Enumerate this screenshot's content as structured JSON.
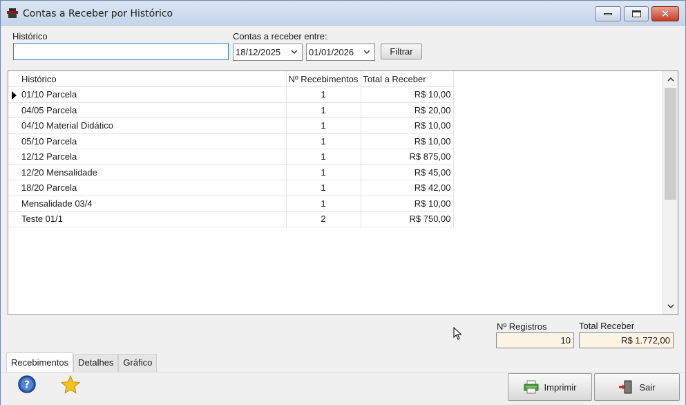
{
  "window": {
    "title": "Contas a Receber por Histórico"
  },
  "filters": {
    "historico_label": "Histórico",
    "historico_value": "",
    "range_label": "Contas a receber entre:",
    "date_from": "18/12/2025",
    "date_to": "01/01/2026",
    "filter_button": "Filtrar"
  },
  "table": {
    "headers": {
      "historico": "Histórico",
      "n_recebimentos": "Nº Recebimentos",
      "total": "Total a Receber"
    },
    "rows": [
      {
        "historico": "01/10 Parcela",
        "n": "1",
        "total": "R$ 10,00"
      },
      {
        "historico": "04/05 Parcela",
        "n": "1",
        "total": "R$ 20,00"
      },
      {
        "historico": "04/10 Material Didático",
        "n": "1",
        "total": "R$ 10,00"
      },
      {
        "historico": "05/10 Parcela",
        "n": "1",
        "total": "R$ 10,00"
      },
      {
        "historico": "12/12 Parcela",
        "n": "1",
        "total": "R$ 875,00"
      },
      {
        "historico": "12/20 Mensalidade",
        "n": "1",
        "total": "R$ 45,00"
      },
      {
        "historico": "18/20 Parcela",
        "n": "1",
        "total": "R$ 42,00"
      },
      {
        "historico": "Mensalidade 03/4",
        "n": "1",
        "total": "R$ 10,00"
      },
      {
        "historico": "Teste 01/1",
        "n": "2",
        "total": "R$ 750,00"
      }
    ]
  },
  "summary": {
    "n_registros_label": "Nº Registros",
    "n_registros_value": "10",
    "total_label": "Total Receber",
    "total_value": "R$ 1.772,00"
  },
  "tabs": [
    {
      "label": "Recebimentos"
    },
    {
      "label": "Detalhes"
    },
    {
      "label": "Gráfico"
    }
  ],
  "buttons": {
    "print": "Imprimir",
    "exit": "Sair"
  },
  "icons": {
    "help": "help-icon",
    "favorite": "star-icon",
    "print": "printer-icon",
    "exit": "exit-door-icon"
  }
}
